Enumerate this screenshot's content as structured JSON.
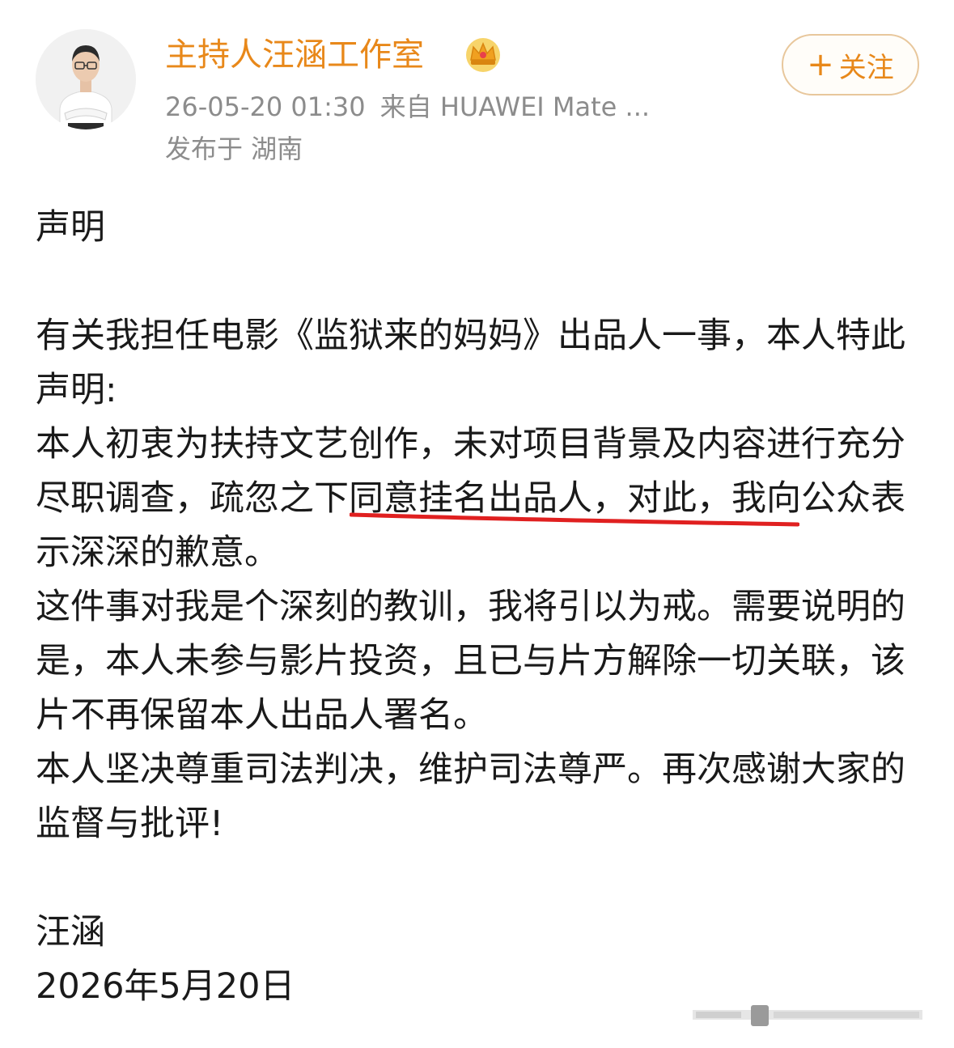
{
  "author": {
    "name": "主持人汪涵工作室",
    "avatar_icon": "person-portrait",
    "badge_icon": "crown-icon",
    "name_color": "#e8881a"
  },
  "meta": {
    "timestamp": "26-05-20 01:30",
    "source": "来自 HUAWEI Mate ...",
    "location": "发布于 湖南"
  },
  "follow_button": {
    "icon": "plus-icon",
    "icon_text": "+",
    "label": "关注"
  },
  "post": {
    "title": "声明",
    "paragraphs": [
      "有关我担任电影《监狱来的妈妈》出品人一事，本人特此声明:",
      "本人初衷为扶持文艺创作，未对项目背景及内容进行充分尽职调查，",
      "疏忽之下同意挂名出品人",
      "，对此，我向公众表示深深的歉意。",
      "这件事对我是个深刻的教训，我将引以为戒。需要说明的是，本人未参与影片投资，且已与片方解除一切关联，该片不再保留本人出品人署名。",
      "本人坚决尊重司法判决，维护司法尊严。再次感谢大家的监督与批评!"
    ],
    "signature": "汪涵",
    "date": "2026年5月20日",
    "highlight_color": "#e02020"
  }
}
